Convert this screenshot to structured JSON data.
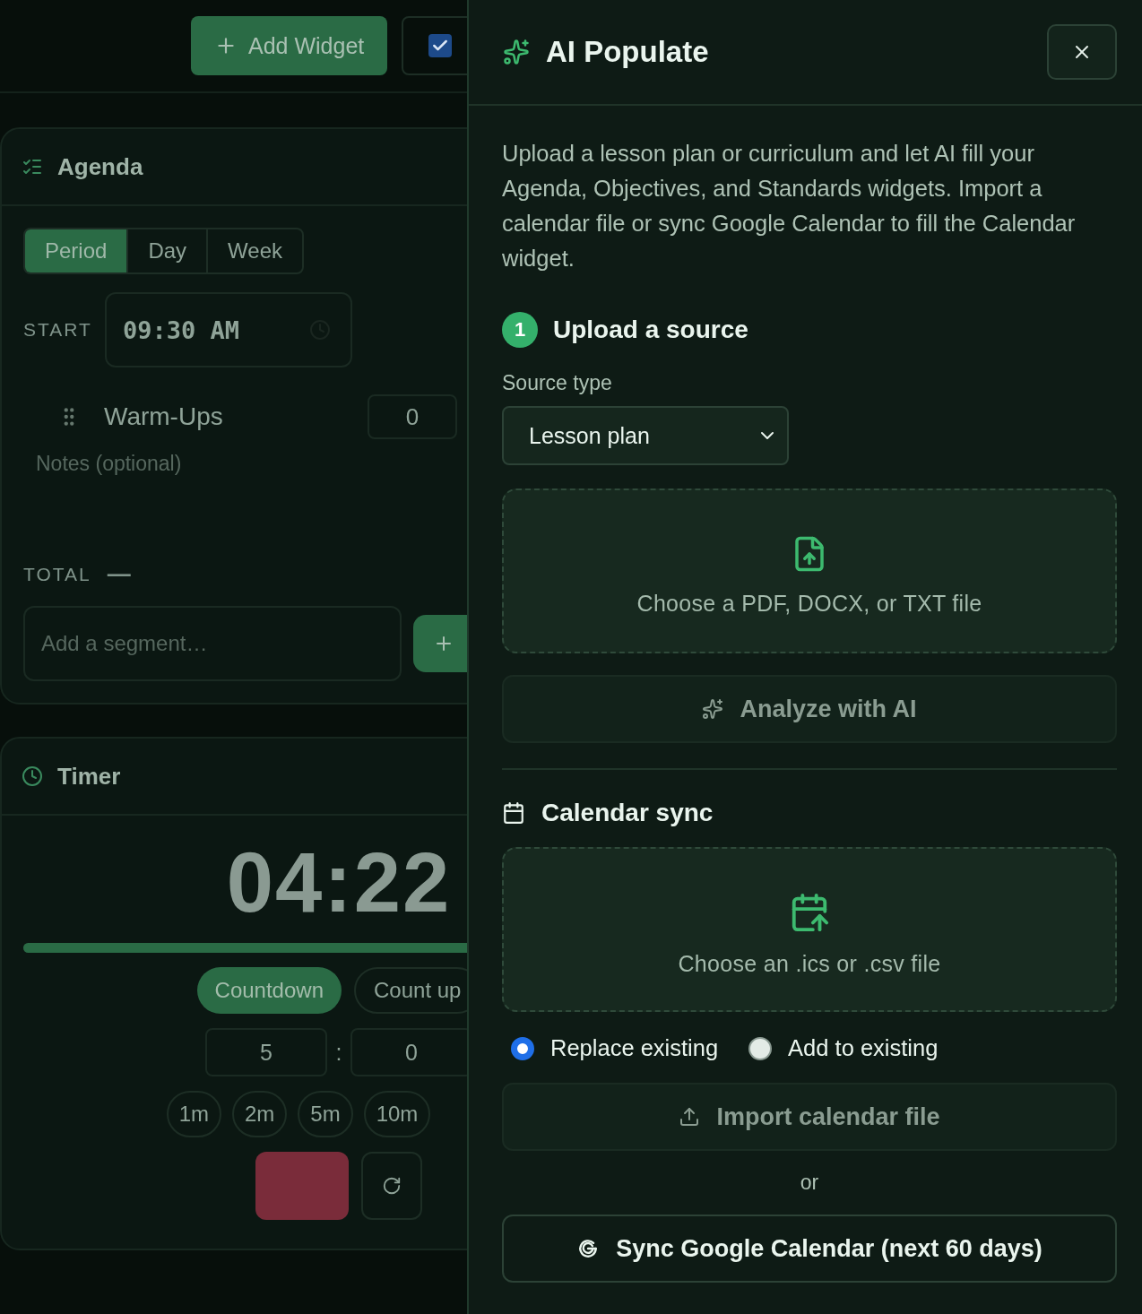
{
  "toolbar": {
    "add_widget": "Add Widget",
    "checkbox_checked": true
  },
  "agenda": {
    "title": "Agenda",
    "tabs": [
      {
        "label": "Period",
        "selected": true
      },
      {
        "label": "Day",
        "selected": false
      },
      {
        "label": "Week",
        "selected": false
      }
    ],
    "start_label": "START",
    "start_time": "09:30 AM",
    "segments": [
      {
        "name": "Warm-Ups",
        "minutes": "0",
        "notes_placeholder": "Notes (optional)"
      }
    ],
    "total_label": "TOTAL",
    "total_value": "—",
    "add_placeholder": "Add a segment…"
  },
  "timer": {
    "title": "Timer",
    "display": "04:22",
    "level": 1,
    "modes": [
      {
        "label": "Countdown",
        "selected": true
      },
      {
        "label": "Count up",
        "selected": false
      }
    ],
    "minutes": "5",
    "separator": ":",
    "seconds": "0",
    "presets": [
      "1m",
      "2m",
      "5m",
      "10m"
    ]
  },
  "panel": {
    "title": "AI Populate",
    "description": "Upload a lesson plan or curriculum and let AI fill your Agenda, Objectives, and Standards widgets. Import a calendar file or sync Google Calendar to fill the Calendar widget.",
    "step": {
      "number": "1",
      "title": "Upload a source"
    },
    "source_type_label": "Source type",
    "source_type": "Lesson plan",
    "source_dropzone": "Choose a PDF, DOCX, or TXT file",
    "analyze_button": {
      "label": "Analyze with AI",
      "disabled": true
    },
    "calendar_title": "Calendar sync",
    "calendar_dropzone": "Choose an .ics or .csv file",
    "import_modes": [
      {
        "label": "Replace existing",
        "selected": true
      },
      {
        "label": "Add to existing",
        "selected": false
      }
    ],
    "import_button": {
      "label": "Import calendar file",
      "disabled": true
    },
    "or": "or",
    "google_button": "Sync Google Calendar (next 60 days)"
  }
}
